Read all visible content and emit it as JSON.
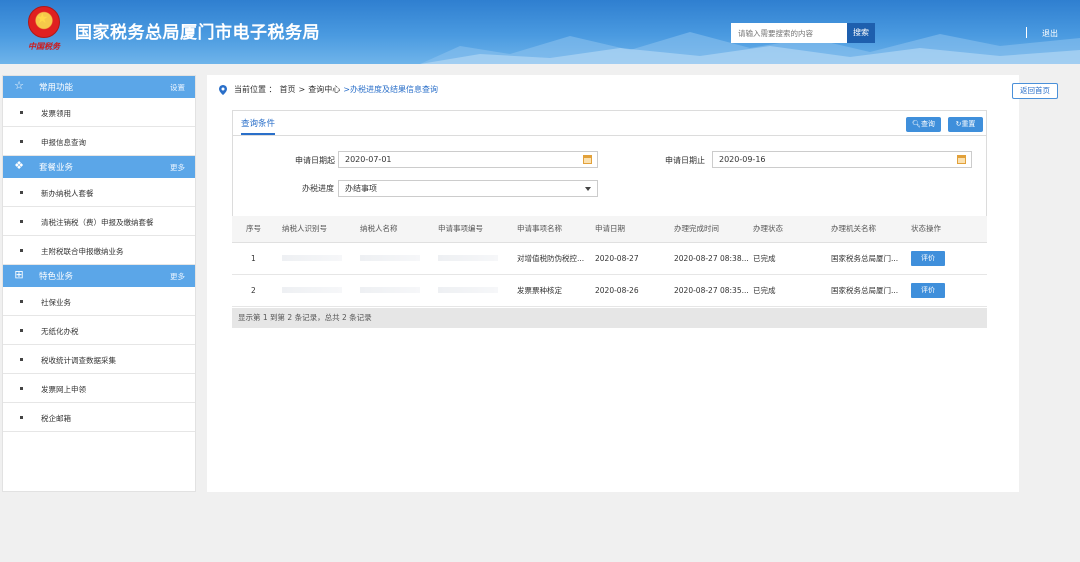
{
  "header": {
    "title": "国家税务总局厦门市电子税务局",
    "emblem_text": "中国税务",
    "search_placeholder": "请输入需要搜索的内容",
    "search_button": "搜索",
    "logout": "退出"
  },
  "sidebar": {
    "sections": [
      {
        "title": "常用功能",
        "action": "设置",
        "icon": "star-icon",
        "items": [
          "发票领用",
          "申报信息查询"
        ]
      },
      {
        "title": "套餐业务",
        "action": "更多",
        "icon": "cube-icon",
        "items": [
          "新办纳税人套餐",
          "清税注销税（费）申报及缴纳套餐",
          "主附税联合申报缴纳业务"
        ]
      },
      {
        "title": "特色业务",
        "action": "更多",
        "icon": "grid-icon",
        "items": [
          "社保业务",
          "无纸化办税",
          "税收统计调查数据采集",
          "发票网上申领",
          "税企邮箱"
        ]
      }
    ]
  },
  "breadcrumb": {
    "prefix": "当前位置 ：",
    "home": "首页",
    "sep1": ">",
    "query_center": "查询中心",
    "current": ">办税进度及结果信息查询"
  },
  "back_button": "返回首页",
  "query": {
    "tab": "查询条件",
    "search_button": "查询",
    "reset_button": "重置",
    "start_label": "申请日期起",
    "start_value": "2020-07-01",
    "end_label": "申请日期止",
    "end_value": "2020-09-16",
    "progress_label": "办税进度",
    "progress_value": "办结事项"
  },
  "table": {
    "headers": [
      "序号",
      "纳税人识别号",
      "纳税人名称",
      "申请事项编号",
      "申请事项名称",
      "申请日期",
      "办理完成时间",
      "办理状态",
      "办理机关名称",
      "状态操作"
    ],
    "rows": [
      {
        "no": "1",
        "item": "对增值税防伪税控...",
        "date": "2020-08-27",
        "done": "2020-08-27 08:38...",
        "status": "已完成",
        "office": "国家税务总局厦门...",
        "action": "评价"
      },
      {
        "no": "2",
        "item": "发票票种核定",
        "date": "2020-08-26",
        "done": "2020-08-27 08:35...",
        "status": "已完成",
        "office": "国家税务总局厦门...",
        "action": "评价"
      }
    ],
    "footer": "显示第 1 到第 2 条记录，总共 2 条记录"
  },
  "colors": {
    "header_blue": "#3b8ad8",
    "accent": "#3f8fdb",
    "sidebar_head": "#5ba6e8"
  }
}
